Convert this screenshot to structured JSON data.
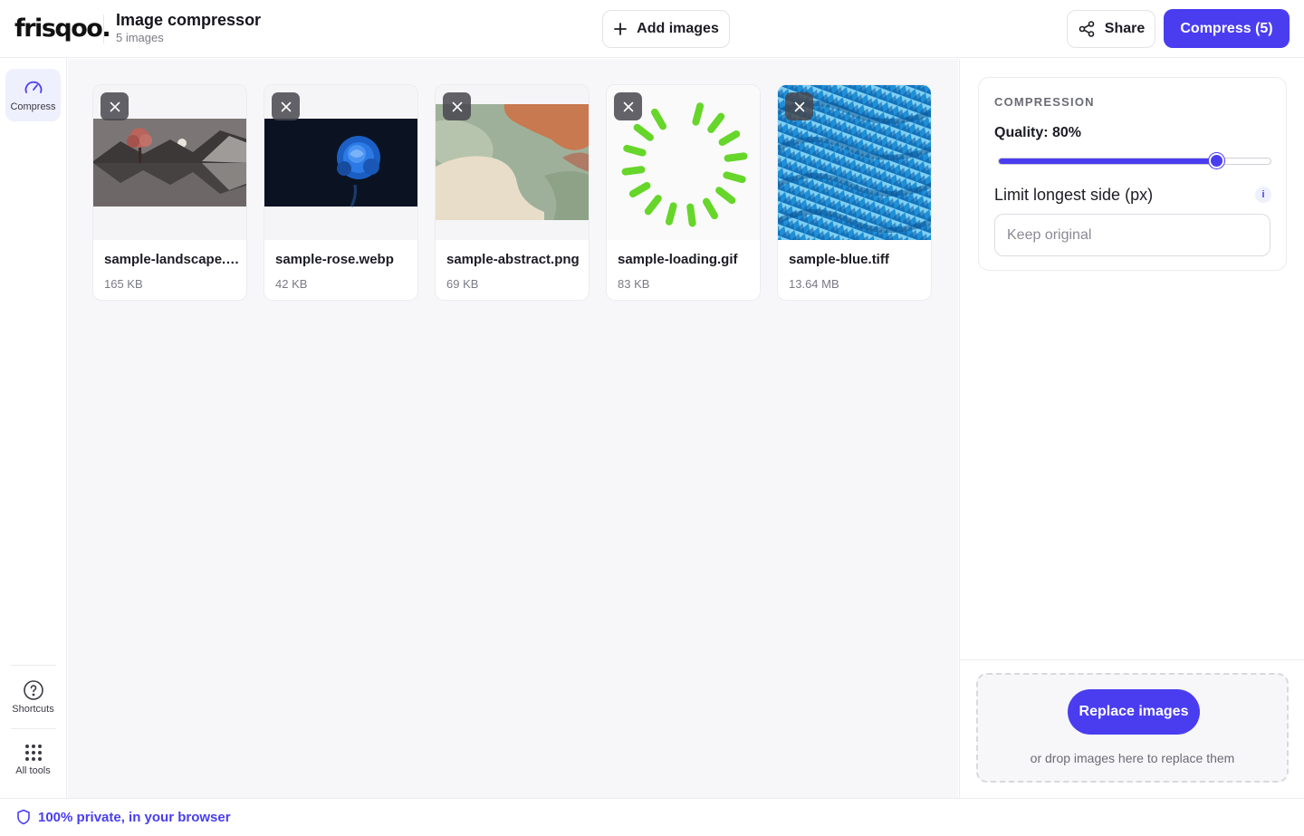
{
  "header": {
    "logo": "frisqoo.",
    "title": "Image compressor",
    "subtitle": "5 images",
    "add_label": "Add images",
    "share_label": "Share",
    "compress_label": "Compress (5)",
    "accent": "#4a3df0"
  },
  "rail": {
    "items": [
      {
        "label": "Compress",
        "icon": "gauge-icon"
      },
      {
        "label": "Shortcuts",
        "icon": "help-circle-icon"
      },
      {
        "label": "All tools",
        "icon": "grid-dots-icon"
      }
    ]
  },
  "files": [
    {
      "name": "sample-landscape.png",
      "size": "165 KB"
    },
    {
      "name": "sample-rose.webp",
      "size": "42 KB"
    },
    {
      "name": "sample-abstract.png",
      "size": "69 KB"
    },
    {
      "name": "sample-loading.gif",
      "size": "83 KB"
    },
    {
      "name": "sample-blue.tiff",
      "size": "13.64 MB"
    }
  ],
  "settings": {
    "section_title": "COMPRESSION",
    "quality_label": "Quality: 80%",
    "quality_value": 80,
    "limit_label": "Limit longest side (px)",
    "limit_info": "i",
    "limit_value": "",
    "limit_placeholder": "Keep original"
  },
  "dropzone": {
    "button_label": "Replace images",
    "hint": "or drop images here to replace them"
  },
  "footer": {
    "privacy": "100% private, in your browser"
  }
}
